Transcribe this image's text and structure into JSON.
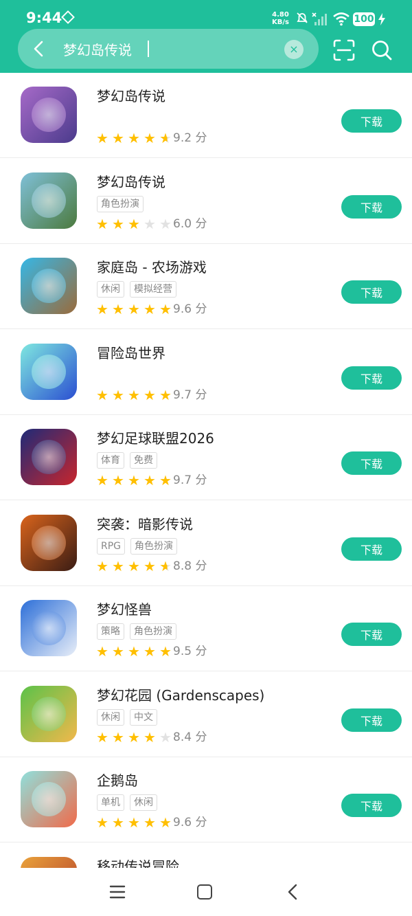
{
  "status_bar": {
    "time": "9:44",
    "net_speed": "4.80",
    "net_unit": "KB/s",
    "battery": "100"
  },
  "search": {
    "query": "梦幻岛传说",
    "clear_glyph": "×"
  },
  "icons": {
    "back": "back-arrow-icon",
    "clear": "close-circle-icon",
    "scan": "scan-icon",
    "search": "search-icon",
    "nav_menu": "menu-icon",
    "nav_home": "home-square-icon",
    "nav_back": "nav-back-icon"
  },
  "colors": {
    "brand": "#1fbf9b",
    "star": "#ffbf00"
  },
  "apps": [
    {
      "title": "梦幻岛传说",
      "tags": [],
      "stars": 4.5,
      "score": "9.2 分",
      "button": "下载",
      "icon_bg": [
        "#a66ac8",
        "#4b3b8c"
      ]
    },
    {
      "title": "梦幻岛传说",
      "tags": [
        "角色扮演"
      ],
      "stars": 3,
      "score": "6.0 分",
      "button": "下载",
      "icon_bg": [
        "#7fc0d8",
        "#4c7a3e"
      ]
    },
    {
      "title": "家庭岛 - 农场游戏",
      "tags": [
        "休闲",
        "模拟经营"
      ],
      "stars": 5,
      "score": "9.6 分",
      "button": "下载",
      "icon_bg": [
        "#36b7e6",
        "#9a6b3b"
      ]
    },
    {
      "title": "冒险岛世界",
      "tags": [],
      "stars": 5,
      "score": "9.7 分",
      "button": "下载",
      "icon_bg": [
        "#7fe8e0",
        "#2b4fd1"
      ]
    },
    {
      "title": "梦幻足球联盟2026",
      "tags": [
        "体育",
        "免费"
      ],
      "stars": 5,
      "score": "9.7 分",
      "button": "下载",
      "icon_bg": [
        "#1e2a78",
        "#c8262d"
      ]
    },
    {
      "title": "突袭：暗影传说",
      "tags": [
        "RPG",
        "角色扮演"
      ],
      "stars": 4.5,
      "score": "8.8 分",
      "button": "下载",
      "icon_bg": [
        "#d9641c",
        "#3a1c14"
      ]
    },
    {
      "title": "梦幻怪兽",
      "tags": [
        "策略",
        "角色扮演"
      ],
      "stars": 5,
      "score": "9.5 分",
      "button": "下载",
      "icon_bg": [
        "#2d6fd8",
        "#e8eef8"
      ]
    },
    {
      "title": "梦幻花园 (Gardenscapes)",
      "tags": [
        "休闲",
        "中文"
      ],
      "stars": 4,
      "score": "8.4 分",
      "button": "下载",
      "icon_bg": [
        "#5bc24a",
        "#f2b84b"
      ]
    },
    {
      "title": "企鹅岛",
      "tags": [
        "单机",
        "休闲"
      ],
      "stars": 5,
      "score": "9.6 分",
      "button": "下载",
      "icon_bg": [
        "#8fe0dc",
        "#f06a4a"
      ]
    },
    {
      "title": "移动传说冒险",
      "tags": [],
      "stars": 0,
      "score": "",
      "button": "",
      "icon_bg": [
        "#e9a23b",
        "#b13a2a"
      ]
    }
  ]
}
